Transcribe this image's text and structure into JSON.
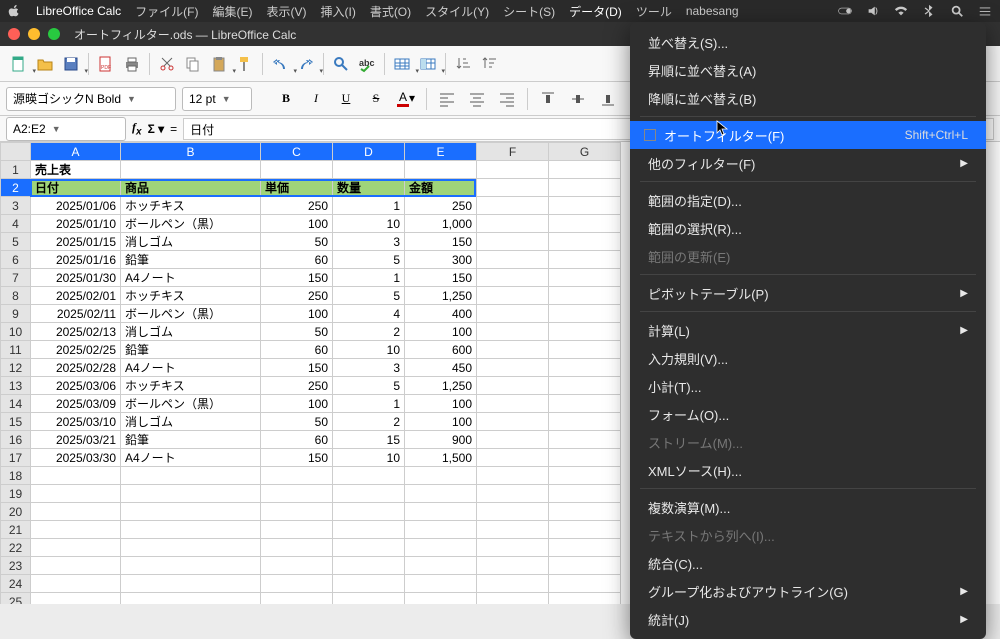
{
  "macmenu": {
    "app": "LibreOffice Calc",
    "items": [
      "ファイル(F)",
      "編集(E)",
      "表示(V)",
      "挿入(I)",
      "書式(O)",
      "スタイル(Y)",
      "シート(S)",
      "データ(D)",
      "ツール",
      "nabesang"
    ]
  },
  "titlebar": "オートフィルター.ods — LibreOffice Calc",
  "fmt": {
    "font": "源暎ゴシックN Bold",
    "size": "12 pt"
  },
  "namebox": {
    "ref": "A2:E2",
    "formula": "日付"
  },
  "columns": [
    "A",
    "B",
    "C",
    "D",
    "E",
    "F",
    "G"
  ],
  "title_cell": "売上表",
  "headers": [
    "日付",
    "商品",
    "単価",
    "数量",
    "金額"
  ],
  "rows": [
    [
      "2025/01/06",
      "ホッチキス",
      "250",
      "1",
      "250"
    ],
    [
      "2025/01/10",
      "ボールペン（黒）",
      "100",
      "10",
      "1,000"
    ],
    [
      "2025/01/15",
      "消しゴム",
      "50",
      "3",
      "150"
    ],
    [
      "2025/01/16",
      "鉛筆",
      "60",
      "5",
      "300"
    ],
    [
      "2025/01/30",
      "A4ノート",
      "150",
      "1",
      "150"
    ],
    [
      "2025/02/01",
      "ホッチキス",
      "250",
      "5",
      "1,250"
    ],
    [
      "2025/02/11",
      "ボールペン（黒）",
      "100",
      "4",
      "400"
    ],
    [
      "2025/02/13",
      "消しゴム",
      "50",
      "2",
      "100"
    ],
    [
      "2025/02/25",
      "鉛筆",
      "60",
      "10",
      "600"
    ],
    [
      "2025/02/28",
      "A4ノート",
      "150",
      "3",
      "450"
    ],
    [
      "2025/03/06",
      "ホッチキス",
      "250",
      "5",
      "1,250"
    ],
    [
      "2025/03/09",
      "ボールペン（黒）",
      "100",
      "1",
      "100"
    ],
    [
      "2025/03/10",
      "消しゴム",
      "50",
      "2",
      "100"
    ],
    [
      "2025/03/21",
      "鉛筆",
      "60",
      "15",
      "900"
    ],
    [
      "2025/03/30",
      "A4ノート",
      "150",
      "10",
      "1,500"
    ]
  ],
  "empty_rows": [
    18,
    19,
    20,
    21,
    22,
    23,
    24,
    25
  ],
  "ctx": {
    "sort": "並べ替え(S)...",
    "asc": "昇順に並べ替え(A)",
    "desc": "降順に並べ替え(B)",
    "autofilter": "オートフィルター(F)",
    "autofilter_sc": "Shift+Ctrl+L",
    "otherfilter": "他のフィルター(F)",
    "defrange": "範囲の指定(D)...",
    "selrange": "範囲の選択(R)...",
    "updrange": "範囲の更新(E)",
    "pivot": "ピボットテーブル(P)",
    "calc": "計算(L)",
    "validity": "入力規則(V)...",
    "subtotal": "小計(T)...",
    "form": "フォーム(O)...",
    "stream": "ストリーム(M)...",
    "xml": "XMLソース(H)...",
    "multiop": "複数演算(M)...",
    "txt2col": "テキストから列へ(I)...",
    "consol": "統合(C)...",
    "outline": "グループ化およびアウトライン(G)",
    "stats": "統計(J)"
  }
}
